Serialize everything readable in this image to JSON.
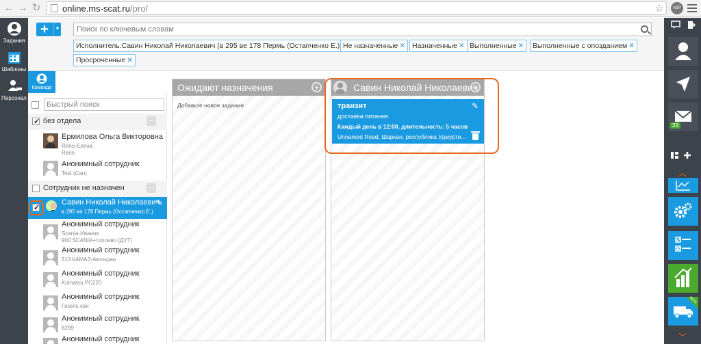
{
  "browser": {
    "url_host": "online.ms-scat.ru",
    "url_path": "/pro/",
    "extension_label": "ABP"
  },
  "leftnav": {
    "items": [
      {
        "label": "Задания"
      },
      {
        "label": "Шаблоны"
      },
      {
        "label": "Персонал"
      }
    ]
  },
  "topbar": {
    "search_placeholder": "Поиск по ключевым словам",
    "filters": [
      "Исполнитель:Савин Николай Николаевич (в 295 ве 178 Пермь (Остапченко Е.))",
      "Не назначенные",
      "Назначенные",
      "Выполненные",
      "Выполненные с опозданием",
      "Просроченные"
    ]
  },
  "team": {
    "tab_label": "Команда",
    "quick_search_placeholder": "Быстрый поиск",
    "groups": [
      {
        "label": "без отдела"
      },
      {
        "label": "Сотрудник не назначен"
      }
    ],
    "employees": [
      {
        "name": "Ермилова Ольга Викторовна",
        "sub": "Reno-Елена",
        "sub2": "Reno"
      },
      {
        "name": "Анонимный сотрудник",
        "sub": "Test (Can)"
      },
      {
        "name": "Савин Николай Николаевич",
        "sub": "в 295 ве 178 Пермь (Остапченко Е.)"
      },
      {
        "name": "Анонимный сотрудник",
        "sub": "Scania-Иванов",
        "sub2": "900 SCANIA+топливо (ДУТ)"
      },
      {
        "name": "Анонимный сотрудник",
        "sub": "513 КАМАЗ-Автокран"
      },
      {
        "name": "Анонимный сотрудник",
        "sub": "Komatsu PC220"
      },
      {
        "name": "Анонимный сотрудник",
        "sub": "Газель кан"
      },
      {
        "name": "Анонимный сотрудник",
        "sub": "8299"
      },
      {
        "name": "Анонимный сотрудник",
        "sub": ""
      }
    ]
  },
  "board": {
    "columns": [
      {
        "title": "Ожидают назначения",
        "hint": "Добавьте новое задание"
      },
      {
        "title": "Савин Николай Николаевич"
      }
    ],
    "card": {
      "title": "транзит",
      "subtitle": "доставка питания",
      "schedule": "Каждый день в 12:00, длительность: 5 часов",
      "address": "Unnamed Road, Шаркан, республика Удмурти..."
    }
  },
  "rightnav": {
    "mail_badge": "33",
    "beta_label": "BETA"
  },
  "colors": {
    "accent": "#1a9ae0",
    "highlight": "#e8691c",
    "nav_bg": "#3d434b",
    "green": "#4aaa2e"
  }
}
